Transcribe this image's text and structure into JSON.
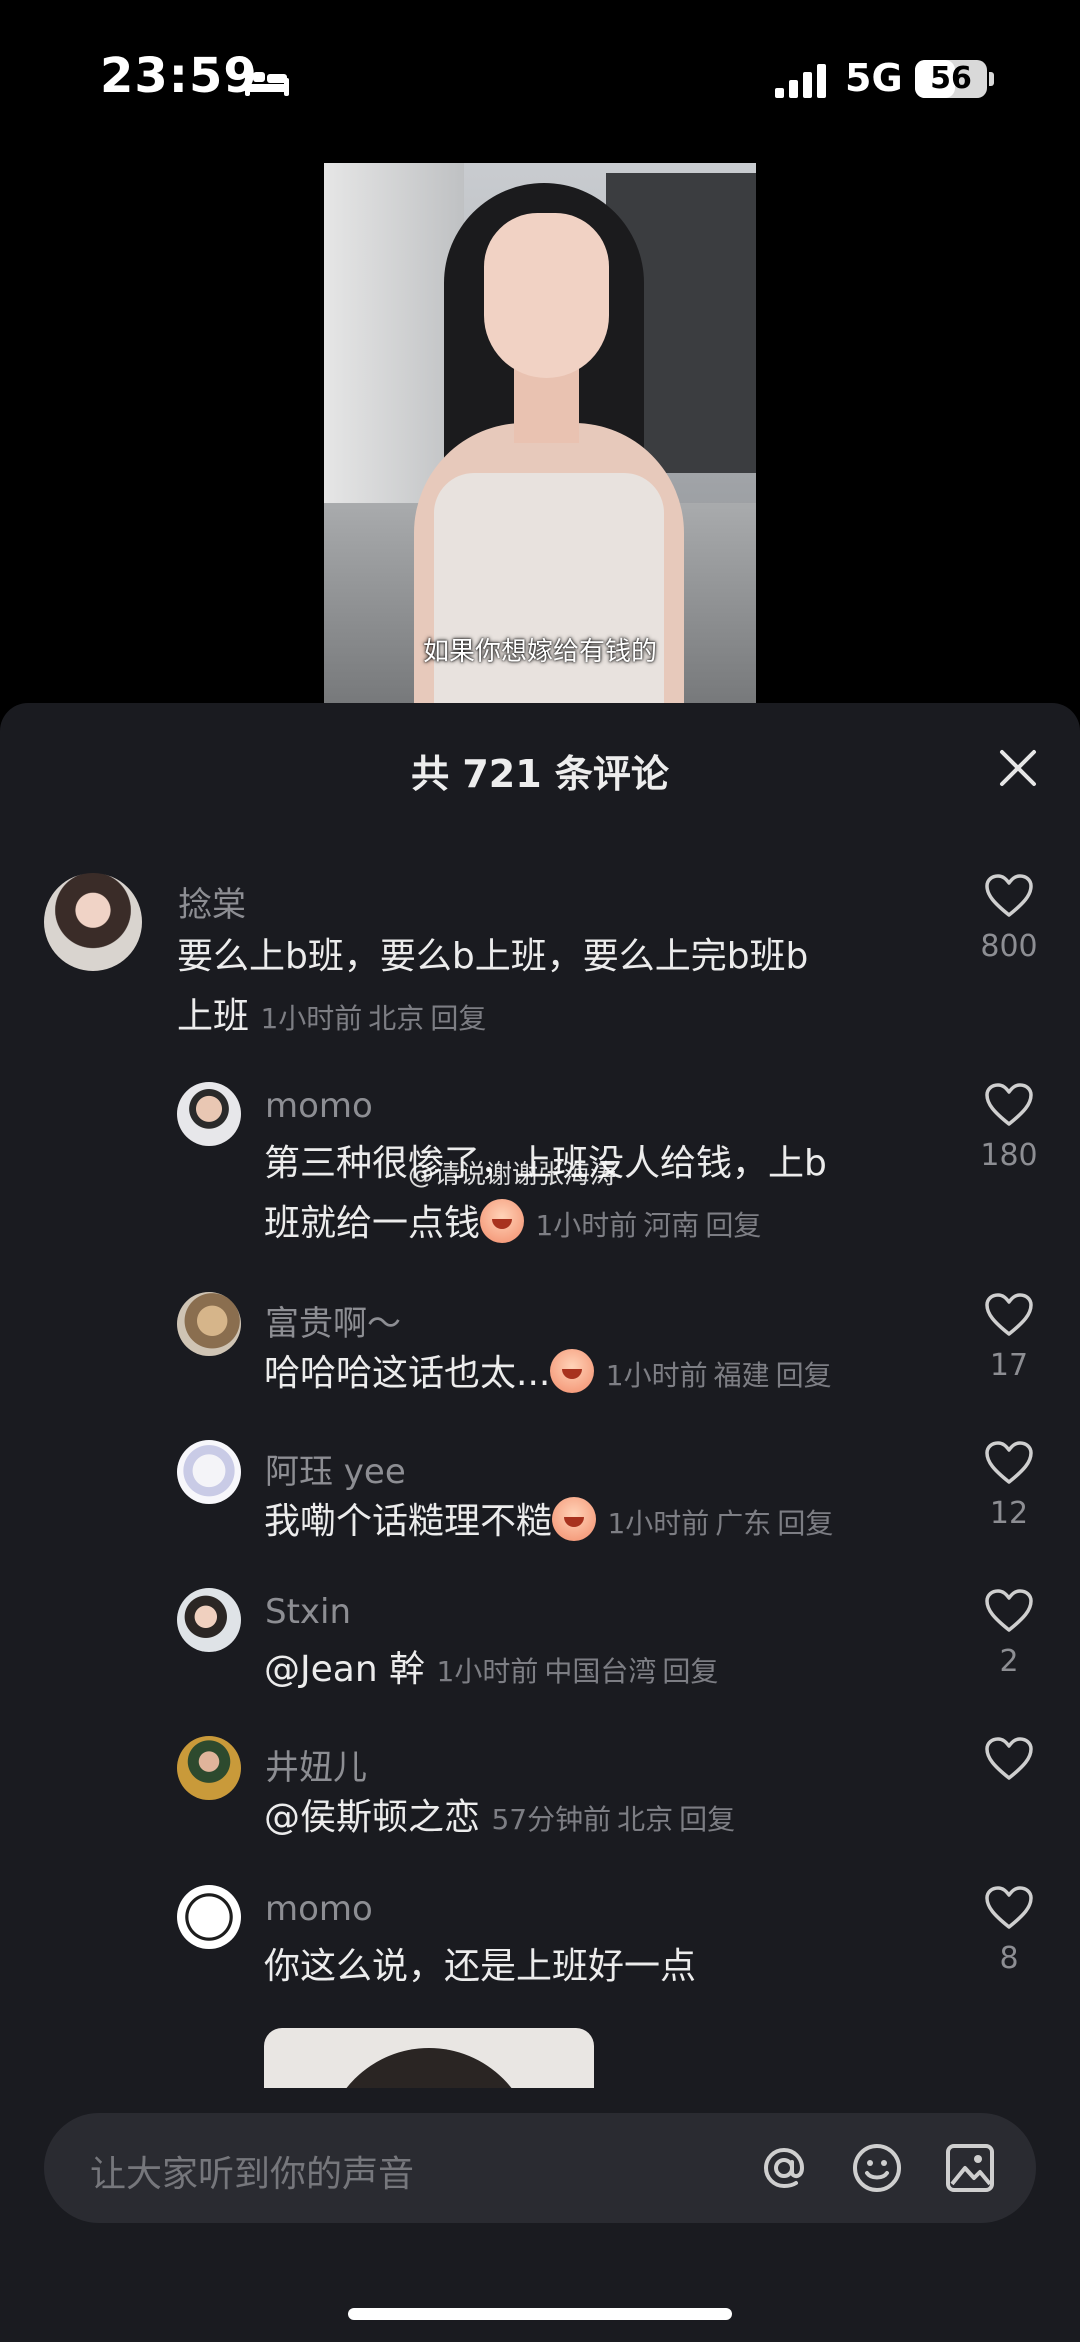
{
  "status": {
    "time": "23:59",
    "network": "5G",
    "battery": "56",
    "battery_level": 0.56
  },
  "video": {
    "subtitle": "如果你想嫁给有钱的"
  },
  "panel": {
    "title": "共 721 条评论"
  },
  "comments": [
    {
      "username": "捻棠",
      "text_line1": "要么上b班，要么b上班，要么上完b班b",
      "text_line2": "上班",
      "time": "1小时前",
      "location": "北京",
      "reply": "回复",
      "likes": "800"
    },
    {
      "username": "momo",
      "text_line1": "第三种很惨了，上班没人给钱，上b",
      "text_line2": "班就给一点钱",
      "time": "1小时前",
      "location": "河南",
      "reply": "回复",
      "likes": "180",
      "watermark": "@请说谢谢张海涛"
    },
    {
      "username": "富贵啊～",
      "text": "哈哈哈这话也太...",
      "time": "1小时前",
      "location": "福建",
      "reply": "回复",
      "likes": "17"
    },
    {
      "username": "阿珏 yee",
      "text": "我嘞个话糙理不糙",
      "time": "1小时前",
      "location": "广东",
      "reply": "回复",
      "likes": "12"
    },
    {
      "username": "Stxin",
      "text": "@Jean 幹",
      "time": "1小时前",
      "location": "中国台湾",
      "reply": "回复",
      "likes": "2"
    },
    {
      "username": "井妞儿",
      "text": "@侯斯顿之恋",
      "time": "57分钟前",
      "location": "北京",
      "reply": "回复",
      "likes": ""
    },
    {
      "username": "momo",
      "text": "你这么说，还是上班好一点",
      "likes": "8"
    }
  ],
  "input": {
    "placeholder": "让大家听到你的声音"
  }
}
